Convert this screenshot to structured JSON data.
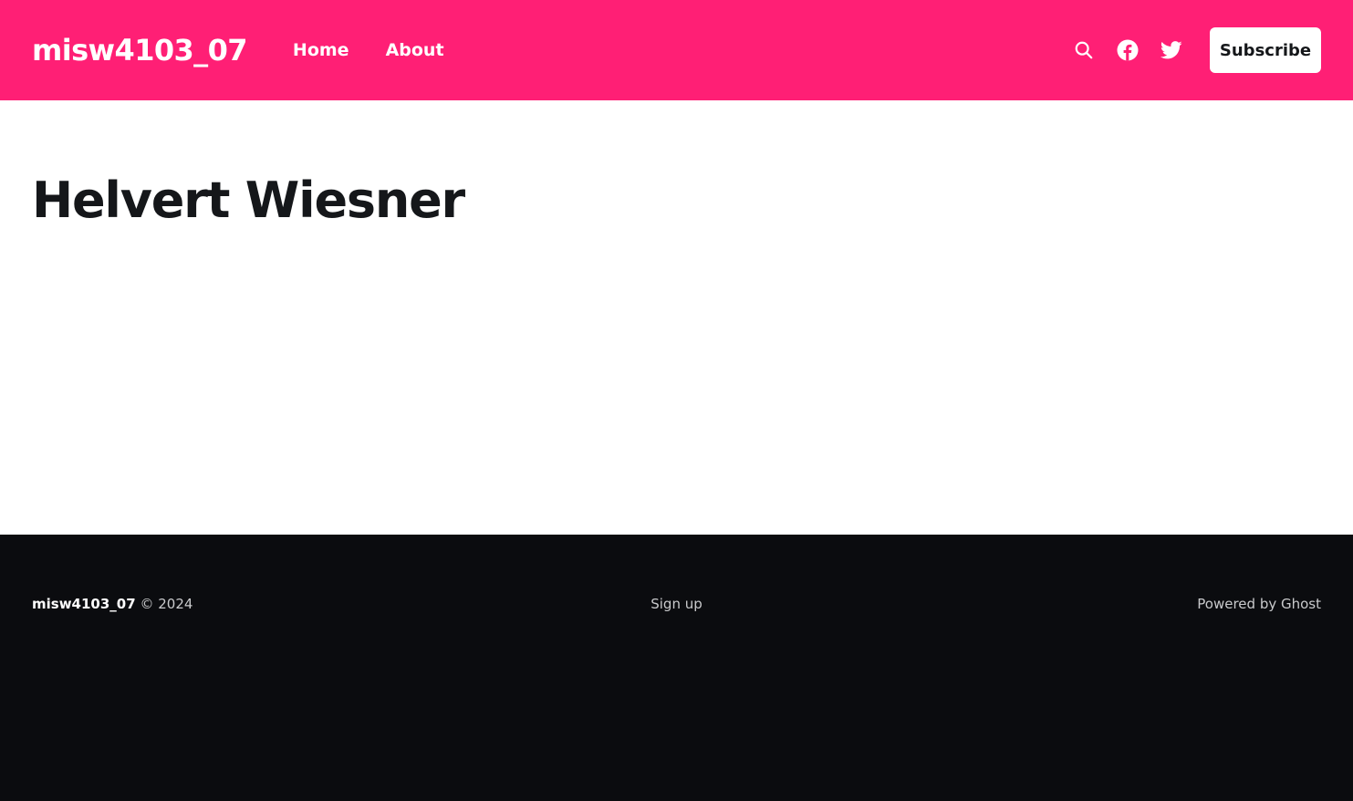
{
  "header": {
    "site_title": "misw4103_07",
    "nav": [
      {
        "label": "Home"
      },
      {
        "label": "About"
      }
    ],
    "icons": [
      "search-icon",
      "facebook-icon",
      "twitter-icon"
    ],
    "subscribe_label": "Subscribe",
    "accent_color": "#ff1f75"
  },
  "main": {
    "author_name": "Helvert Wiesner"
  },
  "footer": {
    "site_title": "misw4103_07",
    "copyright": "© 2024",
    "signup_label": "Sign up",
    "powered_by": "Powered by Ghost",
    "background_color": "#0b0c0f"
  }
}
